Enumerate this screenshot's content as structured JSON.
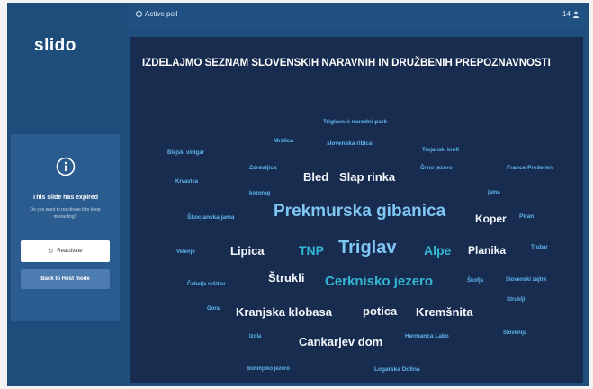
{
  "app": {
    "logo": "slido"
  },
  "topbar": {
    "active_poll": "Active poll",
    "counter": "14"
  },
  "expired_panel": {
    "title": "This slide has expired",
    "subtitle": "Do you want to reactivate it to keep interacting?",
    "reactivate_label": "Reactivate",
    "host_mode_label": "Back to Host mode"
  },
  "slide": {
    "question": "IZDELAJMO SEZNAM SLOVENSKIH NARAVNIH IN DRUŽBENIH PREPOZNAVNOSTI"
  },
  "word_cloud": [
    {
      "text": "Triglavski narodni park"
    },
    {
      "text": "Blejski vintgar"
    },
    {
      "text": "Mrzlica"
    },
    {
      "text": "slovenska ribica"
    },
    {
      "text": "Trojanski krofi"
    },
    {
      "text": "Zdravljica"
    },
    {
      "text": "Bled"
    },
    {
      "text": "Slap rinka"
    },
    {
      "text": "Črno jezero"
    },
    {
      "text": "France Prešeren"
    },
    {
      "text": "Krvavica"
    },
    {
      "text": "kozorog"
    },
    {
      "text": "jama"
    },
    {
      "text": "Škocjanska jama"
    },
    {
      "text": "Prekmurska gibanica"
    },
    {
      "text": "Koper"
    },
    {
      "text": "Piran"
    },
    {
      "text": "Velenje"
    },
    {
      "text": "Lipica"
    },
    {
      "text": "TNP"
    },
    {
      "text": "Triglav"
    },
    {
      "text": "Alpe"
    },
    {
      "text": "Planika"
    },
    {
      "text": "Trubar"
    },
    {
      "text": "Čebelja rešitev"
    },
    {
      "text": "Štrukli"
    },
    {
      "text": "Cerknisko jezero"
    },
    {
      "text": "Škofja"
    },
    {
      "text": "Slovenski zajtrk"
    },
    {
      "text": "Struklji"
    },
    {
      "text": "Gora"
    },
    {
      "text": "Kranjska klobasa"
    },
    {
      "text": "potica"
    },
    {
      "text": "Kremšnita"
    },
    {
      "text": "Izola"
    },
    {
      "text": "Cankarjev dom"
    },
    {
      "text": "Hermanca Labo"
    },
    {
      "text": "Slovenija"
    },
    {
      "text": "Bohinjsko jezero"
    },
    {
      "text": "Logarska Dolina"
    }
  ]
}
